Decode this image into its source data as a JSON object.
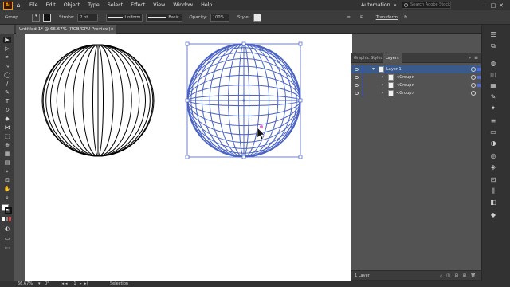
{
  "app": {
    "logo": "Ai"
  },
  "menu": [
    "File",
    "Edit",
    "Object",
    "Type",
    "Select",
    "Effect",
    "View",
    "Window",
    "Help"
  ],
  "workspace": {
    "name": "Automation",
    "search_placeholder": "Search Adobe Stock"
  },
  "control_bar": {
    "selection_label": "Group",
    "stroke_label": "Stroke:",
    "stroke_weight": "2 pt",
    "profile": "Uniform",
    "brush": "Basic",
    "opacity_label": "Opacity:",
    "opacity_value": "100%",
    "style_label": "Style:",
    "transform_label": "Transform",
    "accent_stroke_color": "#000000"
  },
  "document_tab": {
    "title": "Untitled-1* @ 66.67% (RGB/GPU Preview)"
  },
  "layers_panel": {
    "tabs": [
      "Graphic Styles",
      "Layers"
    ],
    "active_tab": "Layers",
    "layers": [
      {
        "name": "Layer 1",
        "selected": true,
        "color": "#4c6cf0"
      },
      {
        "name": "<Group>"
      },
      {
        "name": "<Group>"
      },
      {
        "name": "<Group>"
      }
    ],
    "footer": "1 Layer"
  },
  "status_bar": {
    "zoom": "66.67%",
    "tool": "Selection",
    "artboard_num": "1"
  },
  "colors": {
    "selection_blue": "#4a63c4",
    "artboard": "#ffffff",
    "pasteboard": "#535353"
  }
}
